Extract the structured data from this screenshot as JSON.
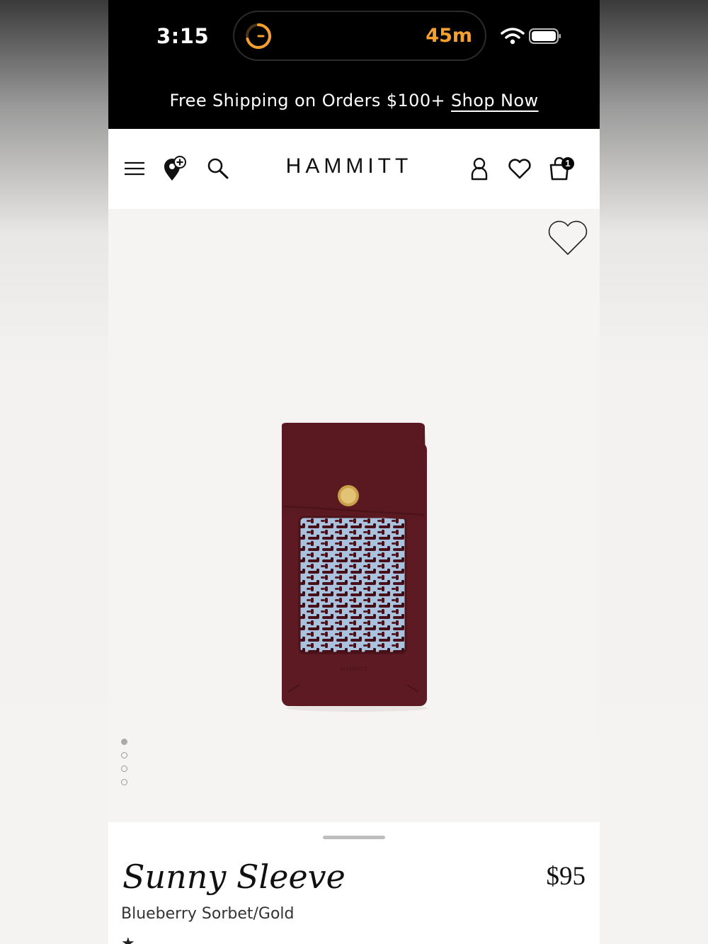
{
  "status_bar": {
    "time": "3:15",
    "timer": "45m",
    "timer_color": "#f5a030"
  },
  "promo": {
    "text": "Free Shipping on Orders $100+",
    "link": "Shop Now"
  },
  "nav": {
    "logo": "HAMMITT",
    "cart_count": "1",
    "icons": [
      "menu-icon",
      "store-locator-icon",
      "search-icon",
      "account-icon",
      "wishlist-icon",
      "cart-icon"
    ]
  },
  "product": {
    "name": "Sunny Sleeve",
    "price": "$95",
    "color": "Blueberry Sorbet/Gold",
    "image_count": 4,
    "active_image": 1,
    "leather_color": "#5e1a22",
    "lining_color": "#a9c3de"
  }
}
